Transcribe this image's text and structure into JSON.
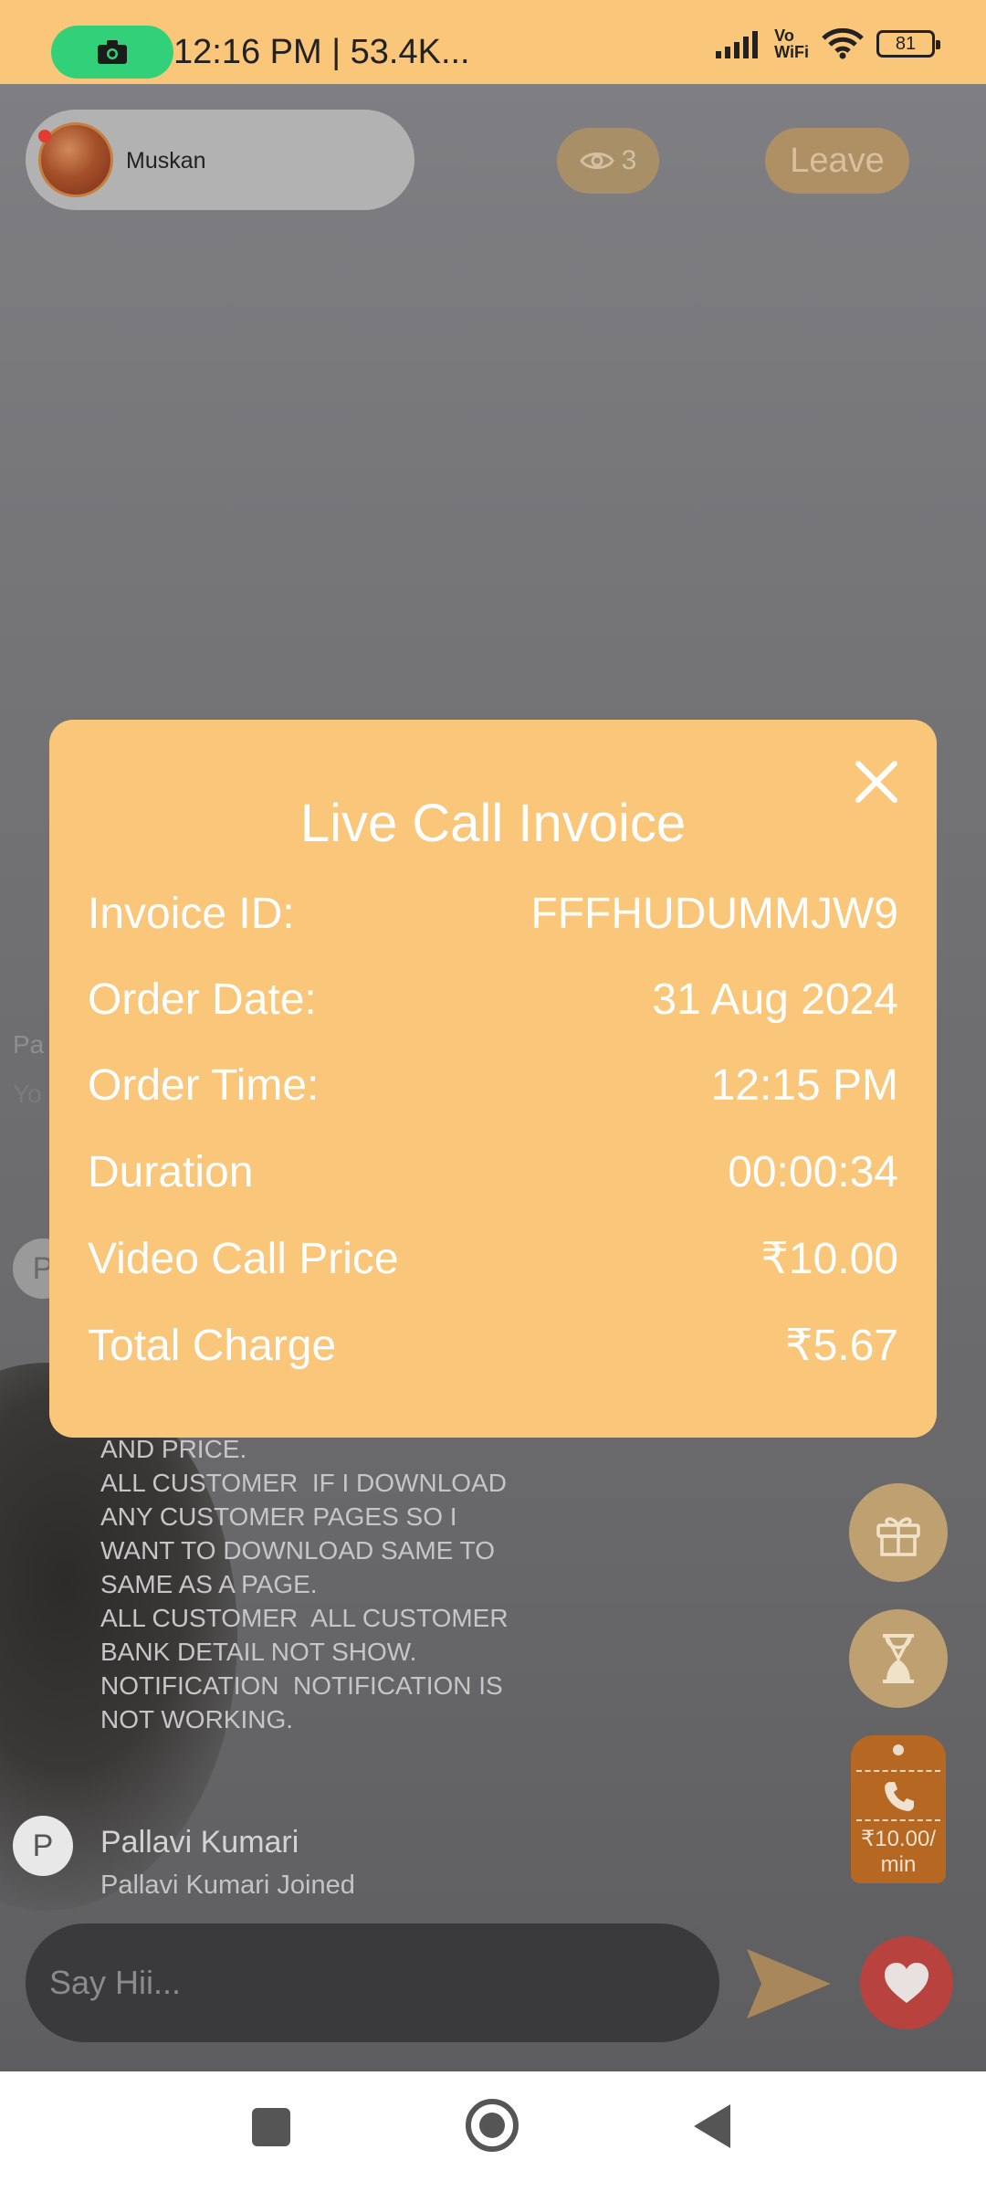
{
  "status_bar": {
    "time_text": "12:16 PM | 53.4K...",
    "network_label_top": "Vo",
    "network_label_bottom": "WiFi",
    "battery": "81"
  },
  "header": {
    "host_name": "Muskan",
    "viewer_count": "3",
    "leave_label": "Leave"
  },
  "chat": {
    "ghost_line_1": "Pa",
    "ghost_line_2": "Yo",
    "ghost_avatar": "P",
    "message_text": "AND PRICE.\nALL CUSTOMER  IF I DOWNLOAD ANY CUSTOMER PAGES SO I WANT TO DOWNLOAD SAME TO SAME AS A PAGE.\nALL CUSTOMER  ALL CUSTOMER BANK DETAIL NOT SHOW.\nNOTIFICATION  NOTIFICATION IS NOT WORKING.",
    "last_avatar": "P",
    "last_name": "Pallavi  Kumari",
    "last_text": "Pallavi  Kumari Joined"
  },
  "side_actions": {
    "call_price": "₹10.00/ min"
  },
  "input": {
    "placeholder": "Say Hii..."
  },
  "invoice": {
    "title": "Live Call Invoice",
    "rows": [
      {
        "label": "Invoice ID:",
        "value": "FFFHUDUMMJW9"
      },
      {
        "label": "Order Date:",
        "value": "31 Aug 2024"
      },
      {
        "label": "Order Time:",
        "value": "12:15 PM"
      },
      {
        "label": "Duration",
        "value": "00:00:34"
      },
      {
        "label": "Video Call Price",
        "value": "₹10.00"
      },
      {
        "label": "Total Charge",
        "value": "₹5.67"
      }
    ]
  },
  "colors": {
    "accent": "#f9c67a",
    "rec_pill": "#33d07a",
    "call_tag": "#b66722",
    "heart": "#b8433e"
  }
}
